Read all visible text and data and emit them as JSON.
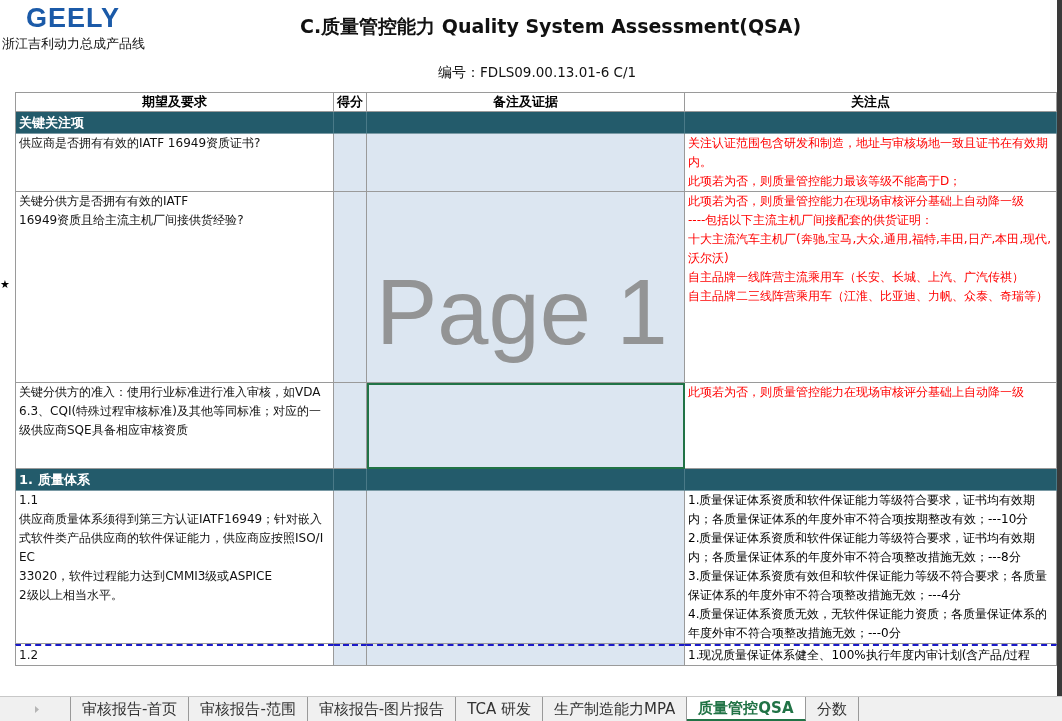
{
  "header": {
    "logo": "GEELY",
    "company": "浙江吉利动力总成产品线",
    "title": "C.质量管控能力 Quality System Assessment(QSA)",
    "doc_number": "编号：FDLS09.00.13.01-6  C/1"
  },
  "columns": [
    "期望及要求",
    "得分",
    "备注及证据",
    "关注点"
  ],
  "sections": [
    {
      "title": "关键关注项",
      "rows": [
        {
          "requirement": [
            "供应商是否拥有有效的IATF 16949资质证书?"
          ],
          "focus": [
            "关注认证范围包含研发和制造，地址与审核场地一致且证书在有效期内。",
            "此项若为否，则质量管控能力最该等级不能高于D；"
          ],
          "color": "#ff0000",
          "evidence_active": false
        },
        {
          "marker": "★",
          "requirement": [
            "关键分供方是否拥有有效的IATF",
            "16949资质且给主流主机厂间接供货经验?"
          ],
          "focus": [
            "此项若为否，则质量管控能力在现场审核评分基础上自动降一级",
            "----包括以下主流主机厂间接配套的供货证明：",
            "十大主流汽车主机厂(奔驰,宝马,大众,通用,福特,丰田,日产,本田,现代,沃尔沃)",
            "自主品牌一线阵营主流乘用车（长安、长城、上汽、广汽传祺）",
            "自主品牌二三线阵营乘用车（江淮、比亚迪、力帆、众泰、奇瑞等）"
          ],
          "color": "#ff0000",
          "evidence_active": false
        },
        {
          "requirement": [
            "关键分供方的准入：使用行业标准进行准入审核，如VDA6.3、CQI(特殊过程审核标准)及其他等同标准；对应的一级供应商SQE具备相应审核资质"
          ],
          "focus": [
            "此项若为否，则质量管控能力在现场审核评分基础上自动降一级"
          ],
          "color": "#ff0000",
          "evidence_active": true
        }
      ]
    },
    {
      "title": "1. 质量体系",
      "rows": [
        {
          "requirement": [
            "1.1",
            "供应商质量体系须得到第三方认证IATF16949；针对嵌入式软件类产品供应商的软件保证能力，供应商应按照ISO/IEC",
            "33020，软件过程能力达到CMMI3级或ASPICE",
            "2级以上相当水平。"
          ],
          "focus": [
            "1.质量保证体系资质和软件保证能力等级符合要求，证书均有效期内；各质量保证体系的年度外审不符合项按期整改有效；---10分",
            "2.质量保证体系资质和软件保证能力等级符合要求，证书均有效期内；各质量保证体系的年度外审不符合项整改措施无效；---8分",
            "3.质量保证体系资质有效但和软件保证能力等级不符合要求；各质量保证体系的年度外审不符合项整改措施无效；---4分",
            "4.质量保证体系资质无效，无软件保证能力资质；各质量保证体系的年度外审不符合项整改措施无效；---0分"
          ],
          "color": "#000000",
          "evidence_active": false
        },
        {
          "page_break": true,
          "requirement": [
            "1.2"
          ],
          "focus": [
            "1.现况质量保证体系健全、100%执行年度内审计划(含产品/过程"
          ],
          "color": "#000000",
          "evidence_active": false
        }
      ]
    }
  ],
  "page_label": "Page 1",
  "sheet_tabs": [
    {
      "label": "审核报告-首页",
      "selected": false
    },
    {
      "label": "审核报告-范围",
      "selected": false
    },
    {
      "label": "审核报告-图片报告",
      "selected": false
    },
    {
      "label": "TCA 研发",
      "selected": false
    },
    {
      "label": "生产制造能力MPA",
      "selected": false
    },
    {
      "label": "质量管控QSA",
      "selected": true
    },
    {
      "label": "分数",
      "selected": false
    }
  ]
}
